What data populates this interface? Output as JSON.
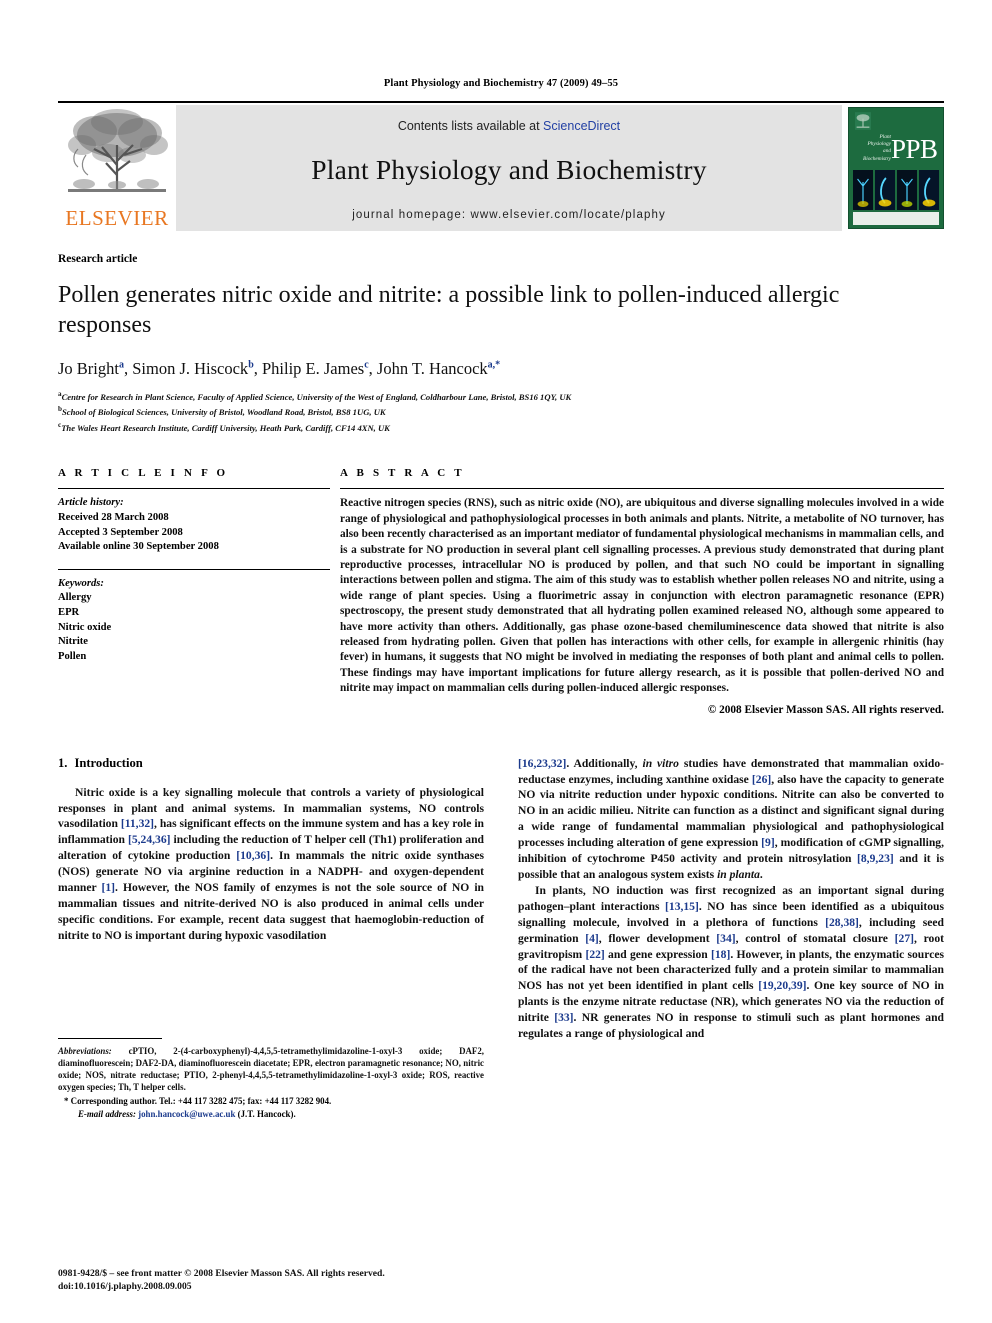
{
  "running_head": "Plant Physiology and Biochemistry 47 (2009) 49–55",
  "masthead": {
    "contents_prefix": "Contents lists available at ",
    "sciencedirect": "ScienceDirect",
    "journal_title": "Plant Physiology and Biochemistry",
    "homepage": "journal homepage: www.elsevier.com/locate/plaphy",
    "publisher_logo_text": "ELSEVIER",
    "cover": {
      "acronym": "PPB",
      "subtitle_lines": [
        "Plant",
        "Physiology",
        "and",
        "Biochemistry"
      ],
      "background_color": "#1d6b3f"
    }
  },
  "article": {
    "kind": "Research article",
    "title": "Pollen generates nitric oxide and nitrite: a possible link to pollen-induced allergic responses",
    "authors": [
      {
        "name": "Jo Bright",
        "marks": "a"
      },
      {
        "name": "Simon J. Hiscock",
        "marks": "b"
      },
      {
        "name": "Philip E. James",
        "marks": "c"
      },
      {
        "name": "John T. Hancock",
        "marks": "a,*"
      }
    ],
    "affiliations": [
      {
        "mark": "a",
        "text": "Centre for Research in Plant Science, Faculty of Applied Science, University of the West of England, Coldharbour Lane, Bristol, BS16 1QY, UK"
      },
      {
        "mark": "b",
        "text": "School of Biological Sciences, University of Bristol, Woodland Road, Bristol, BS8 1UG, UK"
      },
      {
        "mark": "c",
        "text": "The Wales Heart Research Institute, Cardiff University, Heath Park, Cardiff, CF14 4XN, UK"
      }
    ]
  },
  "article_info": {
    "heading": "A R T I C L E  I N F O",
    "history_label": "Article history:",
    "history": [
      "Received 28 March 2008",
      "Accepted 3 September 2008",
      "Available online 30 September 2008"
    ],
    "keywords_label": "Keywords:",
    "keywords": [
      "Allergy",
      "EPR",
      "Nitric oxide",
      "Nitrite",
      "Pollen"
    ]
  },
  "abstract": {
    "heading": "A B S T R A C T",
    "text": "Reactive nitrogen species (RNS), such as nitric oxide (NO), are ubiquitous and diverse signalling molecules involved in a wide range of physiological and pathophysiological processes in both animals and plants. Nitrite, a metabolite of NO turnover, has also been recently characterised as an important mediator of fundamental physiological mechanisms in mammalian cells, and is a substrate for NO production in several plant cell signalling processes. A previous study demonstrated that during plant reproductive processes, intracellular NO is produced by pollen, and that such NO could be important in signalling interactions between pollen and stigma. The aim of this study was to establish whether pollen releases NO and nitrite, using a wide range of plant species. Using a fluorimetric assay in conjunction with electron paramagnetic resonance (EPR) spectroscopy, the present study demonstrated that all hydrating pollen examined released NO, although some appeared to have more activity than others. Additionally, gas phase ozone-based chemiluminescence data showed that nitrite is also released from hydrating pollen. Given that pollen has interactions with other cells, for example in allergenic rhinitis (hay fever) in humans, it suggests that NO might be involved in mediating the responses of both plant and animal cells to pollen. These findings may have important implications for future allergy research, as it is possible that pollen-derived NO and nitrite may impact on mammalian cells during pollen-induced allergic responses.",
    "copyright": "© 2008 Elsevier Masson SAS. All rights reserved."
  },
  "introduction": {
    "number": "1.",
    "heading": "Introduction",
    "left_paragraph_html": "Nitric oxide is a key signalling molecule that controls a variety of physiological responses in plant and animal systems. In mammalian systems, NO controls vasodilation <span class=\"ref\">[11,32]</span>, has significant effects on the immune system and has a key role in inflammation <span class=\"ref\">[5,24,36]</span> including the reduction of T helper cell (Th1) proliferation and alteration of cytokine production <span class=\"ref\">[10,36]</span>. In mammals the nitric oxide synthases (NOS) generate NO via arginine reduction in a NADPH- and oxygen-dependent manner <span class=\"ref\">[1]</span>. However, the NOS family of enzymes is not the sole source of NO in mammalian tissues and nitrite-derived NO is also produced in animal cells under specific conditions. For example, recent data suggest that haemoglobin-reduction of nitrite to NO is important during hypoxic vasodilation",
    "right_paragraph_1_html": "<span class=\"ref\">[16,23,32]</span>. Additionally, <span class=\"ital\">in vitro</span> studies have demonstrated that mammalian oxido-reductase enzymes, including xanthine oxidase <span class=\"ref\">[26]</span>, also have the capacity to generate NO via nitrite reduction under hypoxic conditions. Nitrite can also be converted to NO in an acidic milieu. Nitrite can function as a distinct and significant signal during a wide range of fundamental mammalian physiological and pathophysiological processes including alteration of gene expression <span class=\"ref\">[9]</span>, modification of cGMP signalling, inhibition of cytochrome P450 activity and protein nitrosylation <span class=\"ref\">[8,9,23]</span> and it is possible that an analogous system exists <span class=\"ital\">in planta</span>.",
    "right_paragraph_2_html": "In plants, NO induction was first recognized as an important signal during pathogen–plant interactions <span class=\"ref\">[13,15]</span>. NO has since been identified as a ubiquitous signalling molecule, involved in a plethora of functions <span class=\"ref\">[28,38]</span>, including seed germination <span class=\"ref\">[4]</span>, flower development <span class=\"ref\">[34]</span>, control of stomatal closure <span class=\"ref\">[27]</span>, root gravitropism <span class=\"ref\">[22]</span> and gene expression <span class=\"ref\">[18]</span>. However, in plants, the enzymatic sources of the radical have not been characterized fully and a protein similar to mammalian NOS has not yet been identified in plant cells <span class=\"ref\">[19,20,39]</span>. One key source of NO in plants is the enzyme nitrate reductase (NR), which generates NO via the reduction of nitrite <span class=\"ref\">[33]</span>. NR generates NO in response to stimuli such as plant hormones and regulates a range of physiological and"
  },
  "footnotes": {
    "abbreviations_label": "Abbreviations:",
    "abbreviations_text": "cPTIO, 2-(4-carboxyphenyl)-4,4,5,5-tetramethylimidazoline-1-oxyl-3 oxide; DAF2, diaminofluorescein; DAF2-DA, diaminofluorescein diacetate; EPR, electron paramagnetic resonance; NO, nitric oxide; NOS, nitrate reductase; PTIO, 2-phenyl-4,4,5,5-tetramethylimidazoline-1-oxyl-3 oxide; ROS, reactive oxygen species; Th, T helper cells.",
    "corresponding": "* Corresponding author. Tel.: +44 117 3282 475; fax: +44 117 3282 904.",
    "email_label": "E-mail address:",
    "email": "john.hancock@uwe.ac.uk",
    "email_suffix": "(J.T. Hancock)."
  },
  "imprint": {
    "line1": "0981-9428/$ – see front matter © 2008 Elsevier Masson SAS. All rights reserved.",
    "line2": "doi:10.1016/j.plaphy.2008.09.005"
  }
}
